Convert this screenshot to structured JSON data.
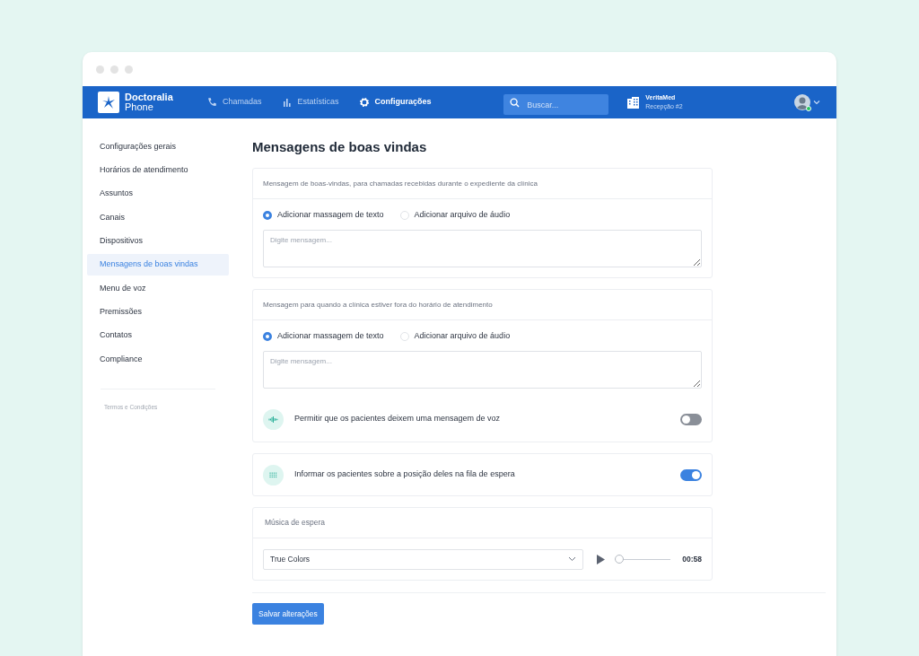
{
  "brand": {
    "name": "Doctoralia",
    "sub": "Phone"
  },
  "nav_tabs": [
    {
      "label": "Chamadas",
      "kind": "phone",
      "selected": false
    },
    {
      "label": "Estatísticas",
      "kind": "chart",
      "selected": false
    },
    {
      "label": "Configurações",
      "kind": "gear",
      "selected": true
    }
  ],
  "search": {
    "placeholder": "Buscar..."
  },
  "clinic": {
    "name": "VeritaMed",
    "sub": "Recepção #2"
  },
  "user": {
    "online": true
  },
  "sidebar": {
    "items": [
      {
        "label": "Configurações gerais",
        "selected": false
      },
      {
        "label": "Horários de atendimento",
        "selected": false
      },
      {
        "label": "Assuntos",
        "selected": false
      },
      {
        "label": "Canais",
        "selected": false
      },
      {
        "label": "Dispositivos",
        "selected": false
      },
      {
        "label": "Mensagens de boas vindas",
        "selected": true
      },
      {
        "label": "Menu de voz",
        "selected": false
      },
      {
        "label": "Premissões",
        "selected": false
      },
      {
        "label": "Contatos",
        "selected": false
      },
      {
        "label": "Compliance",
        "selected": false
      }
    ],
    "footer_link": "Termos e Condições"
  },
  "page_title": "Mensagens de boas vindas",
  "sections": [
    {
      "kind": "message",
      "title": "Mensagem de boas-vindas, para chamadas recebidas durante o expediente da clínica",
      "options": [
        {
          "label": "Adicionar massagem de texto",
          "selected": true
        },
        {
          "label": "Adicionar arquivo de áudio",
          "selected": false
        }
      ],
      "placeholder": "Digite mensagem..."
    },
    {
      "kind": "message",
      "title": "Mensagem para quando a clínica estiver fora do horário de atendimento",
      "options": [
        {
          "label": "Adicionar massagem de texto",
          "selected": true
        },
        {
          "label": "Adicionar arquivo de áudio",
          "selected": false
        }
      ],
      "placeholder": "Digite mensagem...",
      "toggle": {
        "kind": "voice",
        "label": "Permitir que os pacientes deixem uma mensagem de voz",
        "on": false
      }
    },
    {
      "kind": "toggle",
      "toggle": {
        "kind": "queue",
        "label": "Informar os pacientes sobre a posição deles na fila de espera",
        "on": true
      }
    },
    {
      "kind": "music",
      "title": "Música de espera",
      "track": "True Colors",
      "level": 0,
      "time": "00:58"
    }
  ],
  "save_button": "Salvar alterações"
}
